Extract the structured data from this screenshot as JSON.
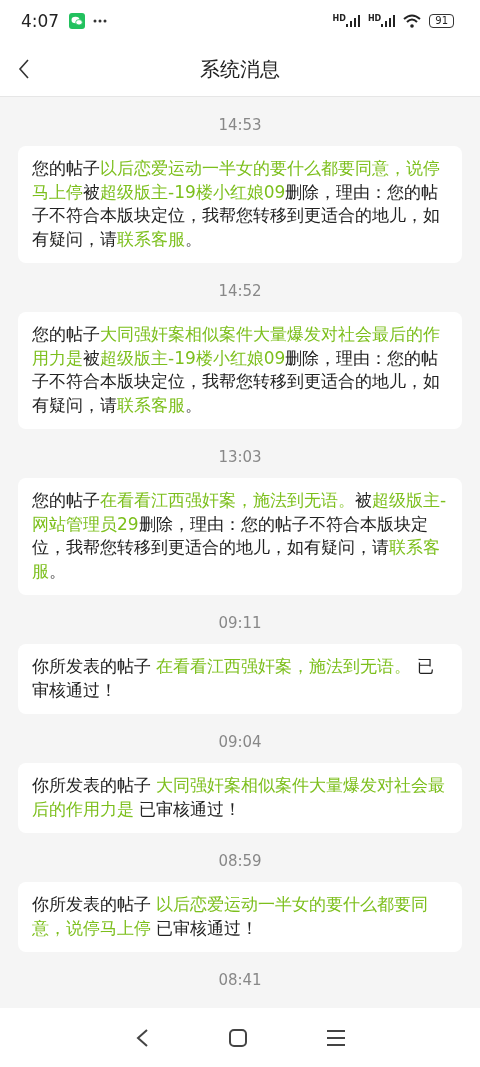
{
  "status_bar": {
    "time": "4:07",
    "signals": [
      {
        "label": "HD"
      },
      {
        "label": "HD"
      }
    ],
    "battery": "91"
  },
  "header": {
    "title": "系统消息"
  },
  "messages": [
    {
      "time": "14:53",
      "segments": [
        {
          "kind": "plain",
          "text": "您的帖子"
        },
        {
          "kind": "highlight",
          "text": "以后恋爱运动一半女的要什么都要同意，说停马上停"
        },
        {
          "kind": "plain",
          "text": "被"
        },
        {
          "kind": "highlight",
          "text": "超级版主-19楼小红娘09"
        },
        {
          "kind": "plain",
          "text": "删除，理由：您的帖子不符合本版块定位，我帮您转移到更适合的地儿，如有疑问，请"
        },
        {
          "kind": "highlight",
          "text": "联系客服"
        },
        {
          "kind": "plain",
          "text": "。"
        }
      ]
    },
    {
      "time": "14:52",
      "segments": [
        {
          "kind": "plain",
          "text": "您的帖子"
        },
        {
          "kind": "highlight",
          "text": "大同强奸案相似案件大量爆发对社会最后的作用力是"
        },
        {
          "kind": "plain",
          "text": "被"
        },
        {
          "kind": "highlight",
          "text": "超级版主-19楼小红娘09"
        },
        {
          "kind": "plain",
          "text": "删除，理由：您的帖子不符合本版块定位，我帮您转移到更适合的地儿，如有疑问，请"
        },
        {
          "kind": "highlight",
          "text": "联系客服"
        },
        {
          "kind": "plain",
          "text": "。"
        }
      ]
    },
    {
      "time": "13:03",
      "segments": [
        {
          "kind": "plain",
          "text": "您的帖子"
        },
        {
          "kind": "highlight",
          "text": "在看看江西强奸案，施法到无语。"
        },
        {
          "kind": "plain",
          "text": "被"
        },
        {
          "kind": "highlight",
          "text": "超级版主-网站管理员29"
        },
        {
          "kind": "plain",
          "text": "删除，理由：您的帖子不符合本版块定位，我帮您转移到更适合的地儿，如有疑问，请"
        },
        {
          "kind": "highlight",
          "text": "联系客服"
        },
        {
          "kind": "plain",
          "text": "。"
        }
      ]
    },
    {
      "time": "09:11",
      "segments": [
        {
          "kind": "plain",
          "text": "你所发表的帖子 "
        },
        {
          "kind": "highlight",
          "text": "在看看江西强奸案，施法到无语。"
        },
        {
          "kind": "plain",
          "text": " 已审核通过！"
        }
      ]
    },
    {
      "time": "09:04",
      "segments": [
        {
          "kind": "plain",
          "text": "你所发表的帖子 "
        },
        {
          "kind": "highlight",
          "text": "大同强奸案相似案件大量爆发对社会最后的作用力是"
        },
        {
          "kind": "plain",
          "text": " 已审核通过！"
        }
      ]
    },
    {
      "time": "08:59",
      "segments": [
        {
          "kind": "plain",
          "text": "你所发表的帖子 "
        },
        {
          "kind": "highlight",
          "text": "以后恋爱运动一半女的要什么都要同意，说停马上停"
        },
        {
          "kind": "plain",
          "text": " 已审核通过！"
        }
      ]
    },
    {
      "time": "08:41"
    }
  ]
}
